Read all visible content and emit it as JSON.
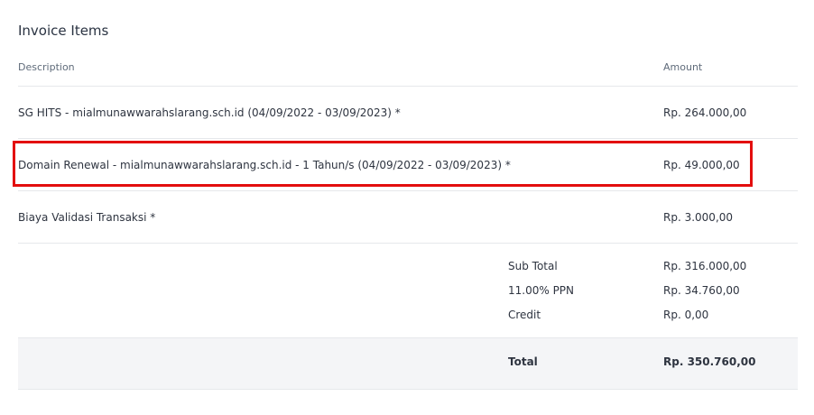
{
  "title": "Invoice Items",
  "headers": {
    "description": "Description",
    "amount": "Amount"
  },
  "items": [
    {
      "description": "SG HITS - mialmunawwarahslarang.sch.id (04/09/2022 - 03/09/2023) *",
      "amount": "Rp. 264.000,00"
    },
    {
      "description": "Domain Renewal - mialmunawwarahslarang.sch.id - 1 Tahun/s (04/09/2022 - 03/09/2023) *",
      "amount": "Rp. 49.000,00"
    },
    {
      "description": "Biaya Validasi Transaksi *",
      "amount": "Rp. 3.000,00"
    }
  ],
  "summary": [
    {
      "label": "Sub Total",
      "amount": "Rp. 316.000,00"
    },
    {
      "label": "11.00% PPN",
      "amount": "Rp. 34.760,00"
    },
    {
      "label": "Credit",
      "amount": "Rp. 0,00"
    }
  ],
  "total": {
    "label": "Total",
    "amount": "Rp. 350.760,00"
  },
  "colors": {
    "highlight_border": "#e30e0e",
    "total_band": "#f4f5f7"
  }
}
